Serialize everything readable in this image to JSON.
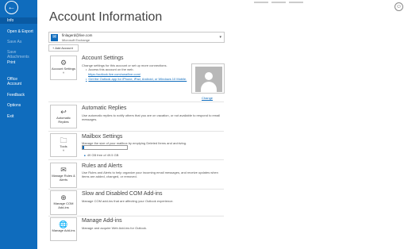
{
  "sidebar": {
    "back": "←",
    "items": [
      {
        "label": "Info",
        "state": "active"
      },
      {
        "label": "Open & Export",
        "state": "normal"
      },
      {
        "label": "Save As",
        "state": "dim"
      },
      {
        "label": "Save Attachments",
        "state": "dim"
      },
      {
        "label": "Print",
        "state": "normal"
      },
      {
        "label": "Office Account",
        "state": "normal"
      },
      {
        "label": "Feedback",
        "state": "normal"
      },
      {
        "label": "Options",
        "state": "normal"
      },
      {
        "label": "Exit",
        "state": "normal"
      }
    ]
  },
  "page": {
    "title": "Account Information"
  },
  "account": {
    "email": "finlagerd@live.com",
    "type": "Microsoft Exchange",
    "add_label": "+ Add Account"
  },
  "settings": {
    "tile_label": "Account Settings ˅",
    "title": "Account Settings",
    "desc": "Change settings for this account or set up more connections.",
    "bullet1": "Access this account on the web.",
    "link1": "https://outlook.live.com/owa/live.com/",
    "bullet2": "Get the Outlook app for iPhone, iPad, Android, or Windows 10 Mobile.",
    "change": "Change"
  },
  "auto": {
    "tile_label": "Automatic Replies",
    "title": "Automatic Replies",
    "desc": "Use automatic replies to notify others that you are on vacation, or not available to respond to email messages."
  },
  "mailbox": {
    "tile_label": "Tools",
    "title": "Mailbox Settings",
    "desc": "Manage the size of your mailbox by emptying Deleted Items and archiving.",
    "usage": "49 GB free of 49.5 GB",
    "used_fraction": 0.01
  },
  "rules": {
    "tile_label": "Manage Rules & Alerts",
    "title": "Rules and Alerts",
    "desc": "Use Rules and Alerts to help organize your incoming email messages, and receive updates when items are added, changed, or removed."
  },
  "com": {
    "tile_label": "Manage COM Add-ins",
    "title": "Slow and Disabled COM Add-ins",
    "desc": "Manage COM add-ins that are affecting your Outlook experience."
  },
  "addins": {
    "tile_label": "Manage Add-ins",
    "title": "Manage Add-ins",
    "desc": "Manage and acquire Web Add-ins for Outlook."
  },
  "colors": {
    "accent": "#0f6cbd"
  }
}
